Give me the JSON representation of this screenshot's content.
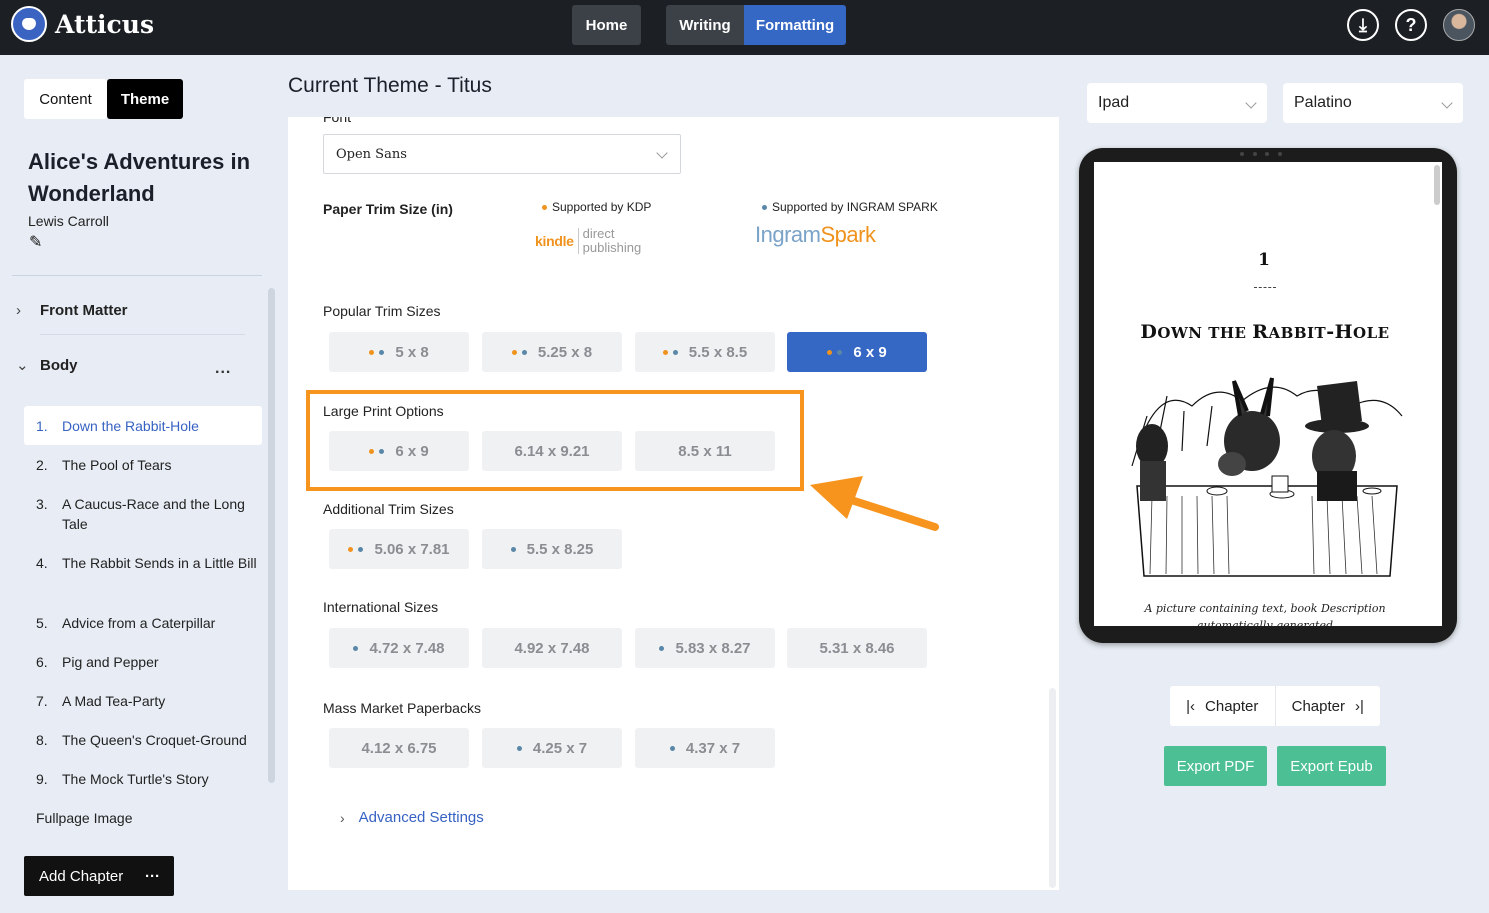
{
  "app": {
    "name": "Atticus"
  },
  "topnav": {
    "home": "Home",
    "writing": "Writing",
    "formatting": "Formatting",
    "download_glyph": "⤓",
    "help_glyph": "?"
  },
  "sidebar": {
    "tabs": {
      "content": "Content",
      "theme": "Theme"
    },
    "book_title": "Alice's Adventures in Wonderland",
    "author": "Lewis Carroll",
    "front_matter": "Front Matter",
    "body": "Body",
    "more": "...",
    "chapters": [
      {
        "num": "1.",
        "title": "Down the Rabbit-Hole",
        "active": true
      },
      {
        "num": "2.",
        "title": "The Pool of Tears"
      },
      {
        "num": "3.",
        "title": "A Caucus-Race and the Long Tale"
      },
      {
        "num": "4.",
        "title": "The Rabbit Sends in a Little Bill"
      },
      {
        "num": "5.",
        "title": "Advice from a Caterpillar"
      },
      {
        "num": "6.",
        "title": "Pig and Pepper"
      },
      {
        "num": "7.",
        "title": "A Mad Tea-Party"
      },
      {
        "num": "8.",
        "title": "The Queen's Croquet-Ground"
      },
      {
        "num": "9.",
        "title": "The Mock Turtle's Story"
      }
    ],
    "fullpage_image": "Fullpage Image",
    "add_chapter": "Add Chapter",
    "add_more": "···"
  },
  "main": {
    "title": "Current Theme - Titus",
    "font_label": "Font",
    "font_value": "Open Sans",
    "trim_label": "Paper Trim Size (in)",
    "supported_kdp": "Supported by KDP",
    "supported_ingram": "Supported by INGRAM SPARK",
    "kdp_logo": {
      "kindle": "kindle",
      "direct": "direct",
      "publishing": "publishing"
    },
    "ingram_logo": {
      "ingram": "Ingram",
      "spark": "Spark"
    },
    "popular_label": "Popular Trim Sizes",
    "popular": [
      {
        "label": "5 x 8",
        "kdp": true,
        "ingram": true
      },
      {
        "label": "5.25 x 8",
        "kdp": true,
        "ingram": true
      },
      {
        "label": "5.5 x 8.5",
        "kdp": true,
        "ingram": true
      },
      {
        "label": "6 x 9",
        "kdp": true,
        "ingram": true,
        "selected": true
      }
    ],
    "large_label": "Large Print Options",
    "large": [
      {
        "label": "6 x 9",
        "kdp": true,
        "ingram": true
      },
      {
        "label": "6.14 x 9.21"
      },
      {
        "label": "8.5 x 11"
      }
    ],
    "additional_label": "Additional Trim Sizes",
    "additional": [
      {
        "label": "5.06 x 7.81",
        "kdp": true,
        "ingram": true
      },
      {
        "label": "5.5 x 8.25",
        "ingram": true
      }
    ],
    "international_label": "International Sizes",
    "international": [
      {
        "label": "4.72 x 7.48",
        "ingram": true
      },
      {
        "label": "4.92 x 7.48"
      },
      {
        "label": "5.83 x 8.27",
        "ingram": true
      },
      {
        "label": "5.31 x 8.46"
      }
    ],
    "mass_label": "Mass Market Paperbacks",
    "mass": [
      {
        "label": "4.12 x 6.75"
      },
      {
        "label": "4.25 x 7",
        "ingram": true
      },
      {
        "label": "4.37 x 7",
        "ingram": true
      }
    ],
    "advanced": "Advanced Settings"
  },
  "preview": {
    "device": "Ipad",
    "font": "Palatino",
    "chapter_number": "1",
    "chapter_title_first": "D",
    "chapter_title_rest_1": "OWN THE ",
    "chapter_title_r": "R",
    "chapter_title_rest_2": "ABBIT",
    "chapter_title_dash": "-H",
    "chapter_title_rest_3": "OLE",
    "caption": "A picture containing text, book Description automatically generated",
    "prev_chapter": "Chapter",
    "next_chapter": "Chapter",
    "export_pdf": "Export PDF",
    "export_epub": "Export Epub"
  },
  "colors": {
    "accent": "#3567c4",
    "kdp_dot": "#f0931e",
    "ingram_dot": "#5a87a8",
    "highlight": "#f7941d",
    "export": "#4dbf95"
  }
}
